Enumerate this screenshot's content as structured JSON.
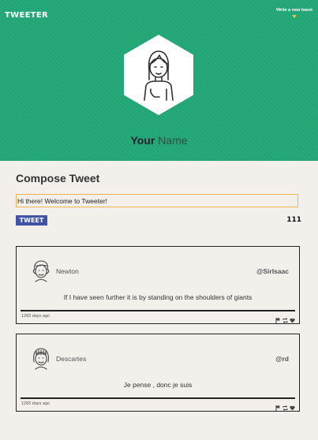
{
  "header": {
    "logo": "TWEETER",
    "write_new": "Write a new tweet",
    "user": {
      "first": "Your",
      "last": "Name"
    }
  },
  "compose": {
    "title": "Compose Tweet",
    "input_value": "Hi there! Welcome to Tweeter!",
    "button_label": "TWEET",
    "counter": "111"
  },
  "tweets": [
    {
      "author": "Newton",
      "handle": "@SirIsaac",
      "text": "If I have seen further it is by standing on the shoulders of giants",
      "age": "1283 days ago"
    },
    {
      "author": "Descartes",
      "handle": "@rd",
      "text": "Je pense , donc je suis",
      "age": "1283 days ago"
    }
  ],
  "colors": {
    "header_bg": "#22a675",
    "accent": "#f0b451",
    "button": "#4054a6",
    "page_bg": "#f3f0eb"
  },
  "icons": [
    "chevron-down-icon",
    "avatar",
    "flag-icon",
    "retweet-icon",
    "heart-icon"
  ]
}
